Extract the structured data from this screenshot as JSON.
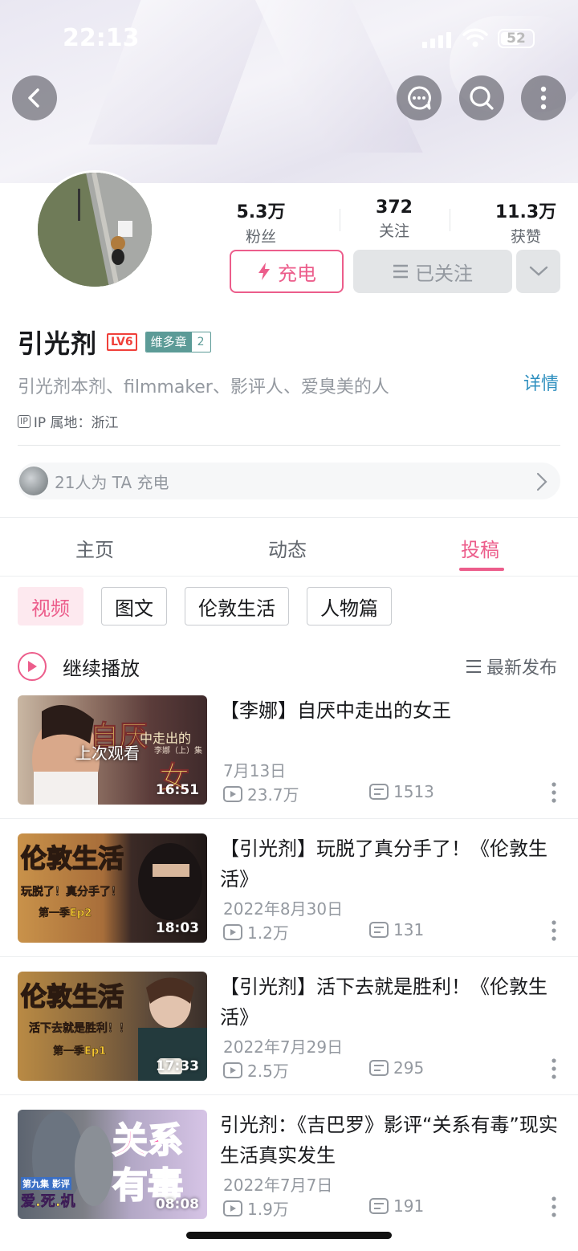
{
  "status_bar": {
    "time": "22:13",
    "battery": "52"
  },
  "header": {
    "back_icon": "chevron-left-icon",
    "message_icon": "chat-bubble-icon",
    "search_icon": "search-icon",
    "more_icon": "more-vertical-icon"
  },
  "profile": {
    "stats": [
      {
        "value": "5.3万",
        "label": "粉丝"
      },
      {
        "value": "372",
        "label": "关注"
      },
      {
        "value": "11.3万",
        "label": "获赞"
      }
    ],
    "charge_label": "充电",
    "follow_label": "已关注",
    "name": "引光剂",
    "level": "LV6",
    "medal_name": "维多章",
    "medal_level": "2",
    "bio": "引光剂本剂、filmmaker、影评人、爱臭美的人",
    "detail_label": "详情",
    "ip_badge": "IP",
    "ip_location": "IP 属地：浙江",
    "charge_count_text": "21人为 TA 充电",
    "accent_color": "#ec5d8b"
  },
  "tabs": [
    {
      "label": "主页",
      "active": false
    },
    {
      "label": "动态",
      "active": false
    },
    {
      "label": "投稿",
      "active": true
    }
  ],
  "chips": [
    {
      "label": "视频",
      "active": true
    },
    {
      "label": "图文",
      "active": false
    },
    {
      "label": "伦敦生活",
      "active": false
    },
    {
      "label": "人物篇",
      "active": false
    }
  ],
  "continue_label": "继续播放",
  "sort_label": "最新发布",
  "videos": [
    {
      "title": "【李娜】自厌中走出的女王",
      "date": "7月13日",
      "views": "23.7万",
      "danmaku": "1513",
      "duration": "16:51",
      "last_watched": "上次观看",
      "thumb_text_1": "自厌",
      "thumb_text_2": "中走出的",
      "thumb_text_3": "女王",
      "thumb_text_4": "李娜（上）集"
    },
    {
      "title": "【引光剂】玩脱了真分手了！《伦敦生活》",
      "date": "2022年8月30日",
      "views": "1.2万",
      "danmaku": "131",
      "duration": "18:03",
      "thumb_text_1": "伦敦生活",
      "thumb_text_2": "玩脱了！真分手了！",
      "thumb_text_3": "第一季Ep2"
    },
    {
      "title": "【引光剂】活下去就是胜利！《伦敦生活》",
      "date": "2022年7月29日",
      "views": "2.5万",
      "danmaku": "295",
      "duration": "17:33",
      "thumb_text_1": "伦敦生活",
      "thumb_text_2": "活下去就是胜利！！",
      "thumb_text_3": "第一季Ep1"
    },
    {
      "title": "引光剂：《吉巴罗》影评“关系有毒”现实生活真实发生",
      "date": "2022年7月7日",
      "views": "1.9万",
      "danmaku": "191",
      "duration": "08:08",
      "thumb_text_1": "关系",
      "thumb_text_2": "有毒",
      "thumb_text_3": "第九集 影评",
      "thumb_text_4": "爱.死.机"
    }
  ]
}
